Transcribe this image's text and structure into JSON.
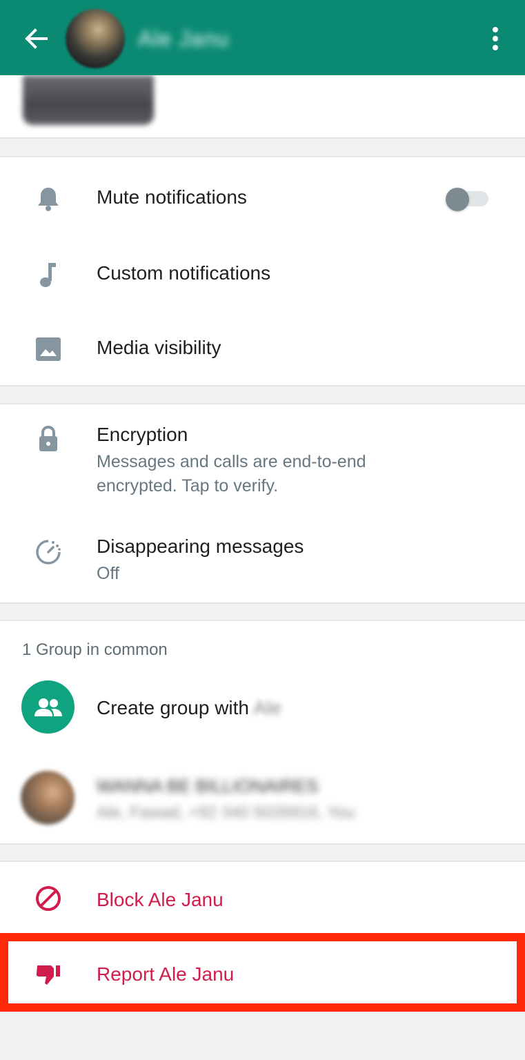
{
  "header": {
    "contact_name": "Ale Janu"
  },
  "settings": {
    "mute_label": "Mute notifications",
    "mute_enabled": false,
    "custom_label": "Custom notifications",
    "media_label": "Media visibility"
  },
  "privacy": {
    "encryption_title": "Encryption",
    "encryption_line1": "Messages and calls are end-to-end",
    "encryption_line2": "encrypted. Tap to verify.",
    "disappearing_title": "Disappearing messages",
    "disappearing_value": "Off"
  },
  "groups": {
    "section_label": "1 Group in common",
    "create_label": "Create group with ",
    "create_name": "Ale",
    "group_name": "WANNA BE BILLIONAIRES",
    "group_members": "Ale, Fawad, +92 340 5026916, You"
  },
  "actions": {
    "block_label": "Block Ale Janu",
    "report_label": "Report Ale Janu"
  },
  "colors": {
    "header_green": "#0a8a73",
    "accent_green": "#10a37f",
    "danger_red": "#d21c4b",
    "highlight_border": "#ff2a0a"
  }
}
